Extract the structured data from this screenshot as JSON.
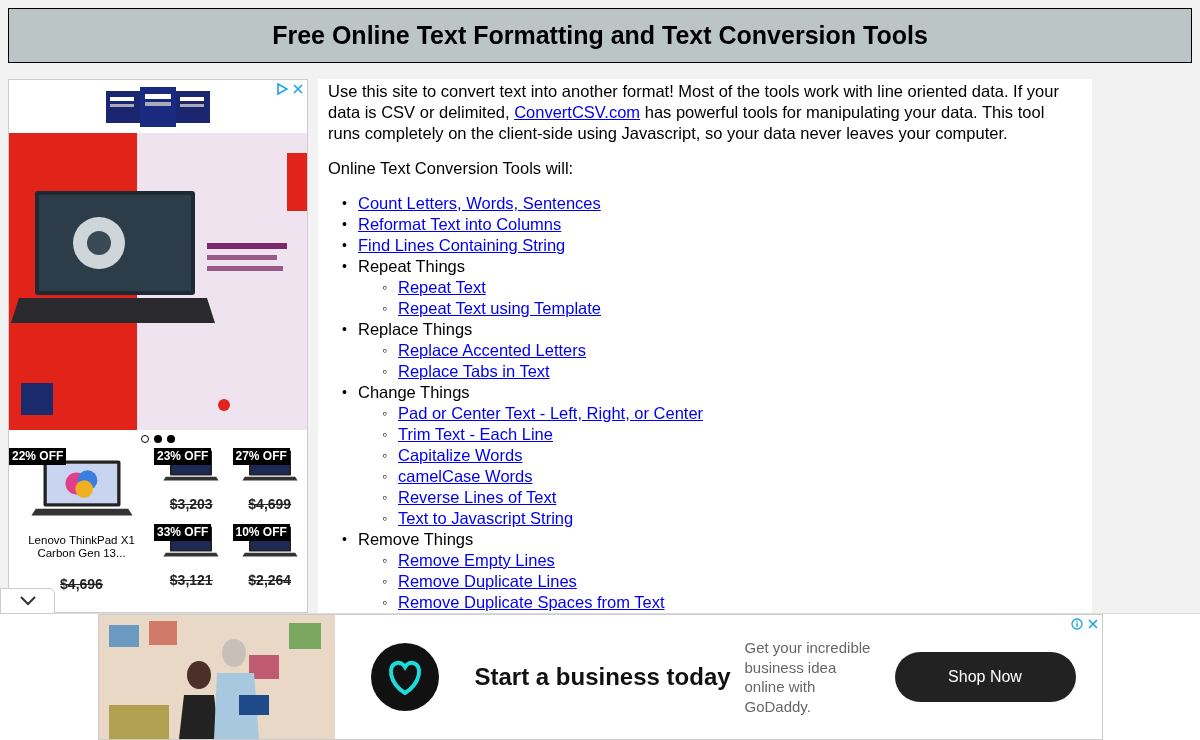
{
  "header": {
    "title": "Free Online Text Formatting and Text Conversion Tools"
  },
  "side_ad": {
    "carousel": [
      {
        "selected": true
      },
      {
        "selected": false
      },
      {
        "selected": false
      }
    ],
    "featured": {
      "badge": "22% OFF",
      "name": "Lenovo ThinkPad X1 Carbon Gen 13...",
      "price": "$4,696"
    },
    "products": [
      {
        "badge": "23% OFF",
        "price": "$3,203"
      },
      {
        "badge": "27% OFF",
        "price": "$4,699"
      },
      {
        "badge": "33% OFF",
        "price": "$3,121"
      },
      {
        "badge": "10% OFF",
        "price": "$2,264"
      }
    ]
  },
  "intro": {
    "before": "Use this site to convert text into another format! Most of the tools work with line oriented data. If your data is CSV or delimited, ",
    "link": "ConvertCSV.com",
    "after": " has powerful tools for manipulating your data. This tool runs completely on the client-side using Javascript, so your data never leaves your computer."
  },
  "list_heading": "Online Text Conversion Tools will:",
  "tools": [
    {
      "kind": "link",
      "marker": "•",
      "label": "Count Letters, Words, Sentences"
    },
    {
      "kind": "link",
      "marker": "•",
      "label": "Reformat Text into Columns"
    },
    {
      "kind": "link",
      "marker": "•",
      "label": "Find Lines Containing String"
    },
    {
      "kind": "group",
      "marker": "•",
      "label": "Repeat Things",
      "children": [
        {
          "kind": "link",
          "marker": "◦",
          "label": "Repeat Text"
        },
        {
          "kind": "link",
          "marker": "◦",
          "label": "Repeat Text using Template"
        }
      ]
    },
    {
      "kind": "group",
      "marker": "•",
      "label": "Replace Things",
      "children": [
        {
          "kind": "link",
          "marker": "◦",
          "label": "Replace Accented Letters"
        },
        {
          "kind": "link",
          "marker": "◦",
          "label": "Replace Tabs in Text"
        }
      ]
    },
    {
      "kind": "group",
      "marker": "•",
      "label": "Change Things",
      "children": [
        {
          "kind": "link",
          "marker": "◦",
          "label": "Pad or Center Text - Left, Right, or Center"
        },
        {
          "kind": "link",
          "marker": "◦",
          "label": "Trim Text - Each Line"
        },
        {
          "kind": "link",
          "marker": "◦",
          "label": "Capitalize Words"
        },
        {
          "kind": "link",
          "marker": "◦",
          "label": "camelCase Words"
        },
        {
          "kind": "link",
          "marker": "◦",
          "label": "Reverse Lines of Text"
        },
        {
          "kind": "link",
          "marker": "◦",
          "label": "Text to Javascript String"
        }
      ]
    },
    {
      "kind": "group",
      "marker": "•",
      "label": "Remove Things",
      "children": [
        {
          "kind": "link",
          "marker": "◦",
          "label": "Remove Empty Lines"
        },
        {
          "kind": "link",
          "marker": "◦",
          "label": "Remove Duplicate Lines"
        },
        {
          "kind": "link",
          "marker": "◦",
          "label": "Remove Duplicate Spaces from Text"
        }
      ]
    }
  ],
  "bottom_ad": {
    "headline": "Start a business today",
    "body": "Get your incredible business idea online with GoDaddy.",
    "button": "Shop Now"
  }
}
